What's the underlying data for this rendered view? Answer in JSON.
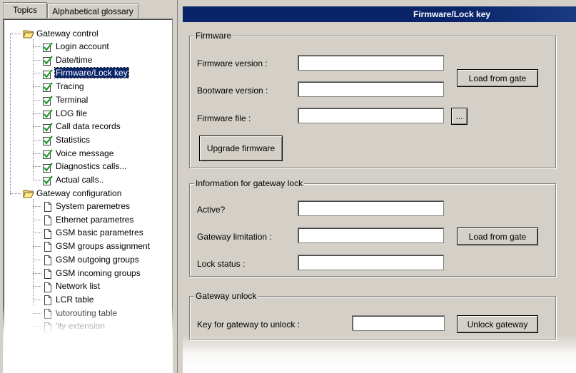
{
  "tabs": [
    {
      "label": "Topics"
    },
    {
      "label": "Alphabetical glossary"
    }
  ],
  "tree": {
    "gateway_control": {
      "label": "Gateway control",
      "items": [
        {
          "label": "Login account"
        },
        {
          "label": "Date/time"
        },
        {
          "label": "Firmware/Lock key"
        },
        {
          "label": "Tracing"
        },
        {
          "label": "Terminal"
        },
        {
          "label": "LOG file"
        },
        {
          "label": "Call data records"
        },
        {
          "label": "Statistics"
        },
        {
          "label": "Voice message"
        },
        {
          "label": "Diagnostics calls..."
        },
        {
          "label": "Actual calls.."
        }
      ]
    },
    "gateway_configuration": {
      "label": "Gateway configuration",
      "items": [
        {
          "label": "System paremetres"
        },
        {
          "label": "Ethernet parametres"
        },
        {
          "label": "GSM basic parametres"
        },
        {
          "label": "GSM groups assignment"
        },
        {
          "label": "GSM outgoing groups"
        },
        {
          "label": "GSM incoming groups"
        },
        {
          "label": "Network list"
        },
        {
          "label": "LCR table"
        },
        {
          "label": "\\utorouting table"
        },
        {
          "label": "'ity extension"
        }
      ]
    }
  },
  "panel": {
    "title": "Firmware/Lock key",
    "firmware": {
      "legend": "Firmware",
      "firmware_version_label": "Firmware version :",
      "firmware_version_value": "",
      "bootware_version_label": "Bootware version :",
      "bootware_version_value": "",
      "firmware_file_label": "Firmware file :",
      "firmware_file_value": "",
      "browse_label": "...",
      "load_from_gate_label": "Load from gate",
      "upgrade_label": "Upgrade firmware"
    },
    "lock": {
      "legend": "Information for gateway lock",
      "active_label": "Active?",
      "active_value": "",
      "limitation_label": "Gateway limitation :",
      "limitation_value": "",
      "lock_status_label": "Lock status :",
      "lock_status_value": "",
      "load_from_gate_label": "Load from gate"
    },
    "unlock": {
      "legend": "Gateway unlock",
      "key_label": "Key for gateway to unlock :",
      "key_value": "",
      "unlock_label": "Unlock gateway"
    }
  },
  "icons": {
    "folder": "open-folder-icon",
    "checked_page": "checked-page-icon",
    "page": "page-icon"
  },
  "colors": {
    "selection": "#0a246a",
    "title_bar": "#0a246a",
    "window_face": "#d4d0c8",
    "check_green": "#1a9a2a",
    "folder_yellow": "#f5d76e"
  }
}
